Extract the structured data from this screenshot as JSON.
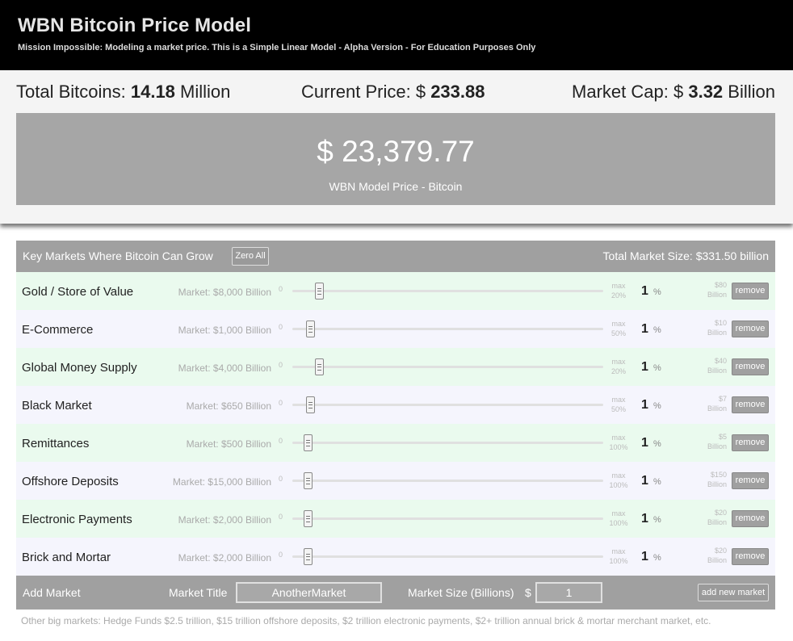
{
  "header": {
    "title": "WBN Bitcoin Price Model",
    "subtitle": "Mission Impossible: Modeling a market price. This is a Simple Linear Model - Alpha Version - For Education Purposes Only"
  },
  "stats": {
    "total_bitcoins_label": "Total Bitcoins:",
    "total_bitcoins_value": "14.18",
    "total_bitcoins_unit": "Million",
    "current_price_label": "Current Price: $",
    "current_price_value": "233.88",
    "market_cap_label": "Market Cap: $",
    "market_cap_value": "3.32",
    "market_cap_unit": "Billion"
  },
  "model": {
    "price": "$ 23,379.77",
    "label": "WBN Model Price - Bitcoin"
  },
  "markets": {
    "heading": "Key Markets Where Bitcoin Can Grow",
    "zero_all_label": "Zero All",
    "total_size": "Total Market Size: $331.50 billion",
    "slider_min": "0",
    "percent_symbol": "%",
    "remove_label": "remove",
    "rows": [
      {
        "title": "Gold / Store of Value",
        "market": "Market: $8,000 Billion",
        "max_line1": "max",
        "max_line2": "20%",
        "percent": "1",
        "value_line1": "$80",
        "value_line2": "Billion",
        "slider_fraction": 0.05
      },
      {
        "title": "E-Commerce",
        "market": "Market: $1,000 Billion",
        "max_line1": "max",
        "max_line2": "50%",
        "percent": "1",
        "value_line1": "$10",
        "value_line2": "Billion",
        "slider_fraction": 0.02
      },
      {
        "title": "Global Money Supply",
        "market": "Market: $4,000 Billion",
        "max_line1": "max",
        "max_line2": "20%",
        "percent": "1",
        "value_line1": "$40",
        "value_line2": "Billion",
        "slider_fraction": 0.05
      },
      {
        "title": "Black Market",
        "market": "Market: $650 Billion",
        "max_line1": "max",
        "max_line2": "50%",
        "percent": "1",
        "value_line1": "$7",
        "value_line2": "Billion",
        "slider_fraction": 0.02
      },
      {
        "title": "Remittances",
        "market": "Market: $500 Billion",
        "max_line1": "max",
        "max_line2": "100%",
        "percent": "1",
        "value_line1": "$5",
        "value_line2": "Billion",
        "slider_fraction": 0.01
      },
      {
        "title": "Offshore Deposits",
        "market": "Market: $15,000 Billion",
        "max_line1": "max",
        "max_line2": "100%",
        "percent": "1",
        "value_line1": "$150",
        "value_line2": "Billion",
        "slider_fraction": 0.01
      },
      {
        "title": "Electronic Payments",
        "market": "Market: $2,000 Billion",
        "max_line1": "max",
        "max_line2": "100%",
        "percent": "1",
        "value_line1": "$20",
        "value_line2": "Billion",
        "slider_fraction": 0.01
      },
      {
        "title": "Brick and Mortar",
        "market": "Market: $2,000 Billion",
        "max_line1": "max",
        "max_line2": "100%",
        "percent": "1",
        "value_line1": "$20",
        "value_line2": "Billion",
        "slider_fraction": 0.01
      }
    ]
  },
  "add_market": {
    "heading": "Add Market",
    "title_label": "Market Title",
    "title_value": "AnotherMarket",
    "size_label": "Market Size (Billions)",
    "dollar": "$",
    "size_value": "1",
    "button_label": "add new market"
  },
  "footnote": "Other big markets: Hedge Funds $2.5 trillion, $15 trillion offshore deposits, $2 trillion electronic payments, $2+ trillion annual brick & mortar merchant market, etc."
}
